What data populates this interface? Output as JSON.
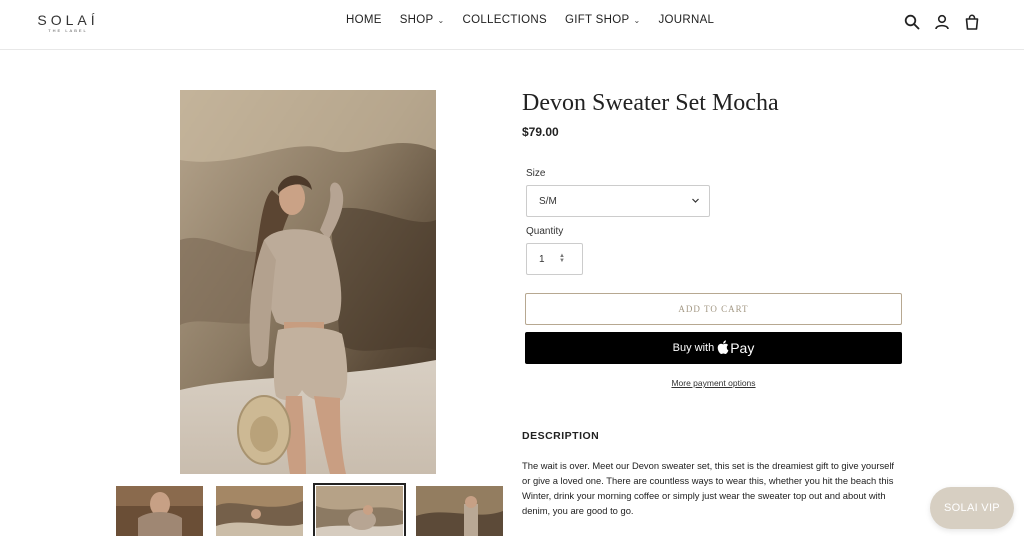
{
  "brand": {
    "name": "SOLAÍ",
    "tagline": "THE LABEL"
  },
  "nav": [
    {
      "label": "HOME",
      "has_dropdown": false
    },
    {
      "label": "SHOP",
      "has_dropdown": true
    },
    {
      "label": "COLLECTIONS",
      "has_dropdown": false
    },
    {
      "label": "GIFT SHOP",
      "has_dropdown": true
    },
    {
      "label": "JOURNAL",
      "has_dropdown": false
    }
  ],
  "header_icons": [
    "search-icon",
    "account-icon",
    "cart-icon"
  ],
  "product": {
    "title": "Devon Sweater Set Mocha",
    "price": "$79.00",
    "size_label": "Size",
    "size_value": "S/M",
    "quantity_label": "Quantity",
    "quantity_value": "1",
    "add_to_cart": "ADD TO CART",
    "buy_with": "Buy with",
    "pay_label": "Pay",
    "more_payment": "More payment options",
    "description_heading": "DESCRIPTION",
    "description": "The wait is over. Meet our Devon sweater set, this set is the dreamiest gift to give yourself or give a loved one. There are countless ways to wear this, whether you hit the beach this Winter, drink your morning coffee or simply just wear the sweater top out and about with denim, you are good to go.",
    "thumbnails": 4,
    "active_thumbnail": 3
  },
  "vip_button": "SOLAI VIP",
  "colors": {
    "accent_border": "#b7a891",
    "accent_text": "#a39884",
    "vip_bg": "#d7cfc2",
    "buy_bg": "#000000"
  }
}
